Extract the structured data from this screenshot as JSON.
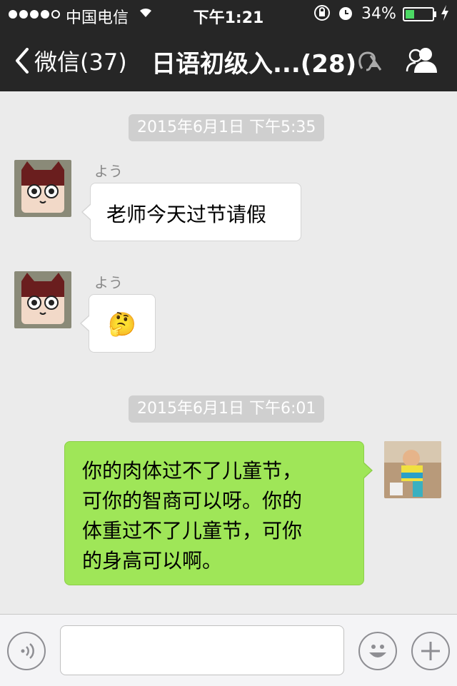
{
  "status_bar": {
    "carrier": "中国电信",
    "time": "下午1:21",
    "battery_percent": "34%",
    "battery_level": 0.34
  },
  "nav": {
    "back_label": "微信(37)",
    "title": "日语初级入...(28)"
  },
  "messages": [
    {
      "type": "timestamp",
      "text": "2015年6月1日 下午5:35"
    },
    {
      "type": "incoming",
      "sender": "よう",
      "text": "老师今天过节请假"
    },
    {
      "type": "incoming",
      "sender": "よう",
      "text": "🤔"
    },
    {
      "type": "timestamp",
      "text": "2015年6月1日 下午6:01"
    },
    {
      "type": "outgoing",
      "lines": [
        "你的肉体过不了儿童节，",
        "可你的智商可以呀。你的",
        "体重过不了儿童节，可你",
        "的身高可以啊。"
      ]
    }
  ],
  "input": {
    "placeholder": ""
  },
  "icons": {
    "back": "chevron-left-icon",
    "mute": "mute-icon",
    "group": "group-members-icon",
    "voice": "voice-icon",
    "emoji": "emoji-icon",
    "add": "plus-icon"
  },
  "colors": {
    "nav_bg": "#262626",
    "chat_bg": "#ebebeb",
    "outgoing_bubble": "#9fe658",
    "incoming_bubble": "#ffffff",
    "timestamp_bg": "#cfcfcf"
  }
}
